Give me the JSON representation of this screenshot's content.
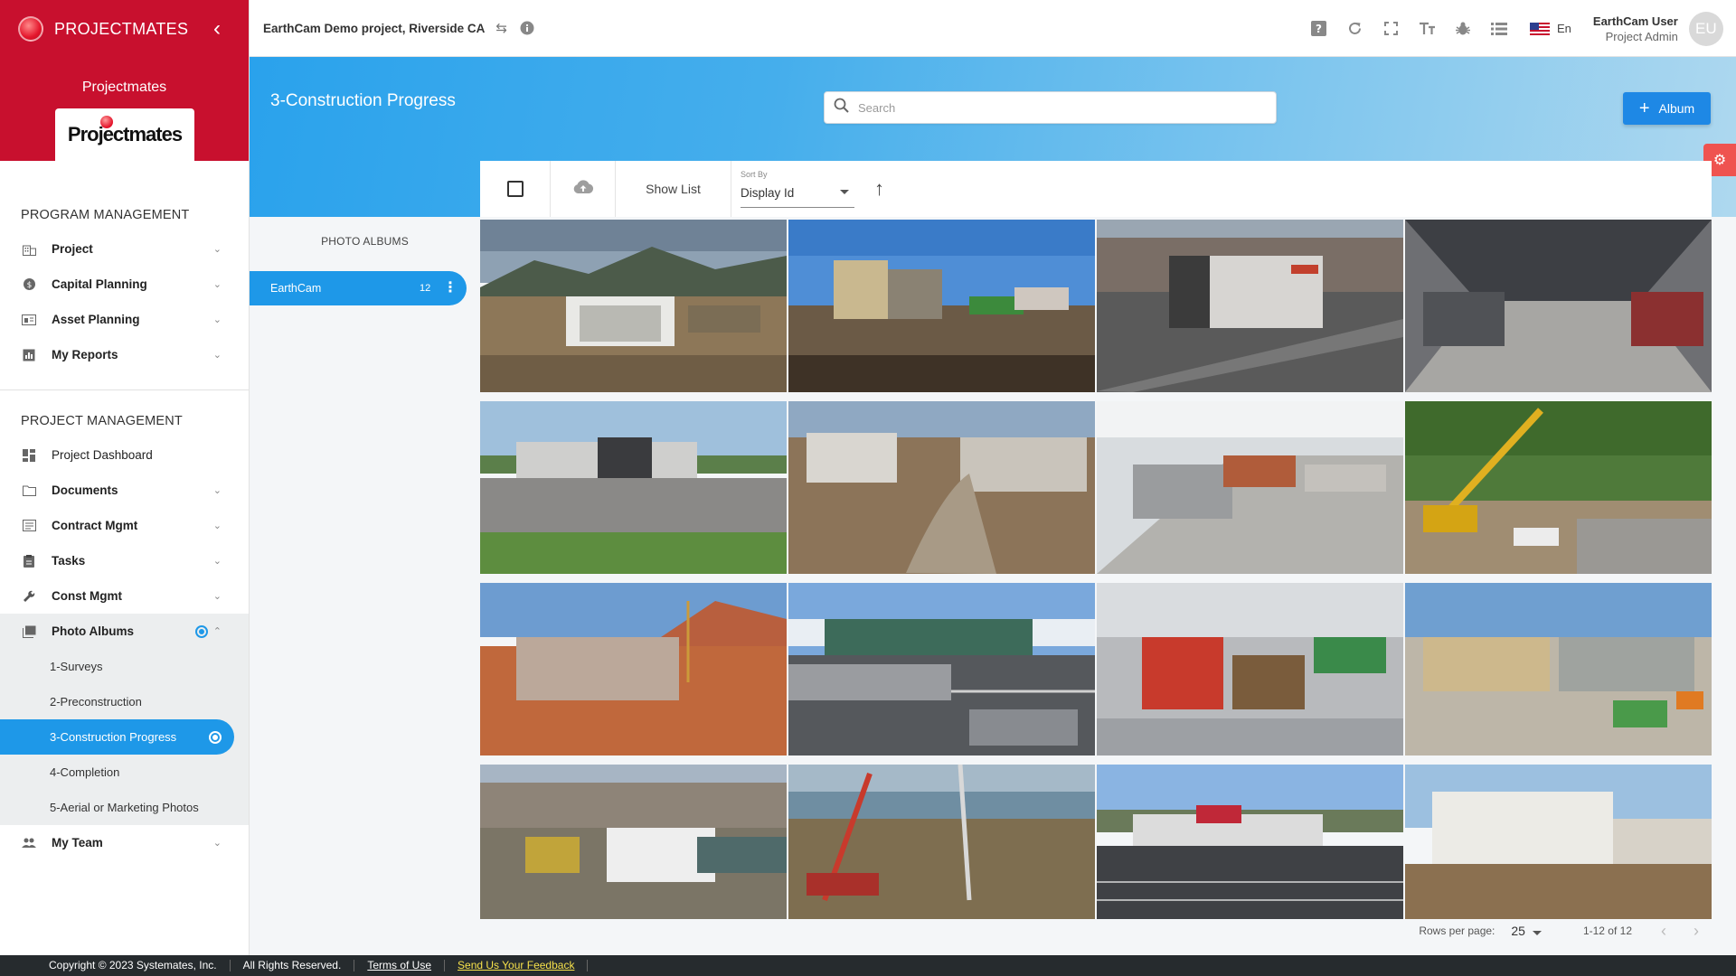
{
  "app": {
    "brand_name": "PROJECTMATES",
    "org_name": "Projectmates",
    "logo_text": "Projectmates"
  },
  "header": {
    "project_name": "EarthCam Demo project, Riverside CA",
    "language": "En",
    "user_name": "EarthCam User",
    "user_role": "Project Admin",
    "avatar_initials": "EU",
    "icons": [
      "help-icon",
      "refresh-icon",
      "fullscreen-icon",
      "text-size-icon",
      "bug-icon",
      "list-view-icon"
    ]
  },
  "sidebar": {
    "program_title": "PROGRAM MANAGEMENT",
    "program_items": [
      {
        "label": "Project",
        "icon": "building-icon"
      },
      {
        "label": "Capital Planning",
        "icon": "dollar-icon"
      },
      {
        "label": "Asset Planning",
        "icon": "asset-icon"
      },
      {
        "label": "My Reports",
        "icon": "report-icon"
      }
    ],
    "project_title": "PROJECT MANAGEMENT",
    "project_items": {
      "dashboard": "Project Dashboard",
      "documents": "Documents",
      "contract": "Contract Mgmt",
      "tasks": "Tasks",
      "const": "Const Mgmt",
      "photo_albums": "Photo Albums",
      "my_team": "My Team"
    },
    "photo_album_subs": [
      "1-Surveys",
      "2-Preconstruction",
      "3-Construction Progress",
      "4-Completion",
      "5-Aerial or Marketing Photos"
    ]
  },
  "main": {
    "title": "3-Construction Progress",
    "search_placeholder": "Search",
    "add_album_label": "Album",
    "albums_heading": "PHOTO ALBUMS",
    "album": {
      "name": "EarthCam",
      "count": "12"
    },
    "toolbar": {
      "show_list_label": "Show List",
      "sort_label": "Sort By",
      "sort_value": "Display Id"
    },
    "pager": {
      "rows_label": "Rows per page:",
      "rows_value": "25",
      "range": "1-12 of 12"
    }
  },
  "footer": {
    "copyright": "Copyright © 2023 Systemates, Inc.",
    "rights": "All Rights Reserved.",
    "terms": "Terms of Use",
    "feedback": "Send Us Your Feedback"
  },
  "colors": {
    "brand_red": "#c8102e",
    "accent_blue": "#1e98e8",
    "button_blue": "#1e88e5",
    "footer_bg": "#262b2e"
  }
}
